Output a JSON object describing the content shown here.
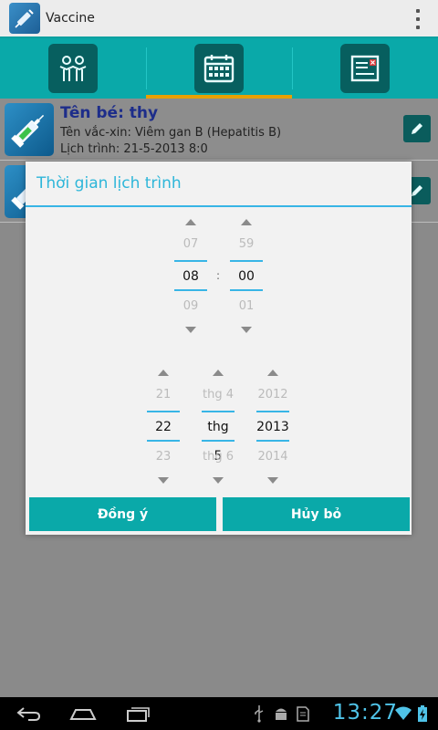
{
  "app": {
    "title": "Vaccine"
  },
  "tabs": [
    {
      "id": "children",
      "icon": "children-icon"
    },
    {
      "id": "schedule",
      "icon": "calendar-icon",
      "active": true
    },
    {
      "id": "records",
      "icon": "records-icon"
    }
  ],
  "list": [
    {
      "name": "Tên bé: thy",
      "vaccine": "Tên vắc-xin: Viêm gan B (Hepatitis B)",
      "schedule": "Lịch trình: 21-5-2013 8:0"
    },
    {
      "name": "",
      "vaccine": "",
      "schedule": ""
    }
  ],
  "dialog": {
    "title": "Thời gian lịch trình",
    "time": {
      "hour": {
        "prev": "07",
        "current": "08",
        "next": "09"
      },
      "separator": ":",
      "minute": {
        "prev": "59",
        "current": "00",
        "next": "01"
      }
    },
    "date": {
      "day": {
        "prev": "21",
        "current": "22",
        "next": "23"
      },
      "month": {
        "prev": "thg 4",
        "current": "thg 5",
        "next": "thg 6"
      },
      "year": {
        "prev": "2012",
        "current": "2013",
        "next": "2014"
      }
    },
    "buttons": {
      "ok": "Đồng ý",
      "cancel": "Hủy bỏ"
    }
  },
  "status": {
    "clock": "13:27"
  },
  "colors": {
    "accent": "#0aa9a9",
    "title_blue": "#2eb6d9",
    "active_tab": "#e8a000"
  }
}
